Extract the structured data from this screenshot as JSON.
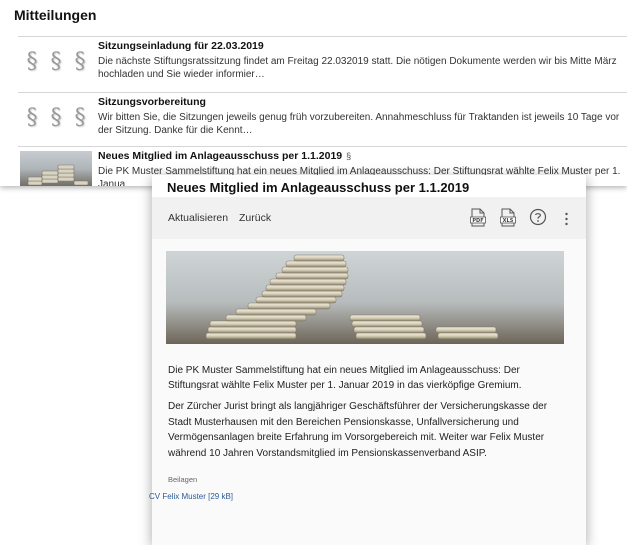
{
  "messages": {
    "heading": "Mitteilungen",
    "items": [
      {
        "title": "Sitzungseinladung für 22.03.2019",
        "body": "Die nächste Stiftungsratssitzung findet am Freitag 22.032019 statt. Die nötigen Dokumente werden wir bis Mitte März hochladen und Sie wieder informier…",
        "thumb": "paragraph-icons"
      },
      {
        "title": "Sitzungsvorbereitung",
        "body": "Wir bitten Sie, die Sitzungen jeweils genug früh vorzubereiten. Annahmeschluss für Traktanden ist jeweils 10 Tage vor der Sitzung. Danke für die Kennt…",
        "thumb": "paragraph-icons"
      },
      {
        "title": "Neues Mitglied im Anlageausschuss per 1.1.2019",
        "flag": "§",
        "body": "Die PK Muster Sammelstiftung hat ein neues Mitglied im Anlageausschuss: Der Stiftungsrat wählte Felix Muster per 1. Janua",
        "thumb": "coin-stack-photo"
      }
    ]
  },
  "dialog": {
    "title": "Neues Mitglied im Anlageausschuss per 1.1.2019",
    "toolbar": {
      "refresh_label": "Aktualisieren",
      "back_label": "Zurück",
      "icons": [
        "pdf-icon",
        "xls-icon",
        "help-icon",
        "more-icon"
      ]
    },
    "paragraph1": "Die PK Muster Sammelstiftung hat ein neues Mitglied im Anlageausschuss: Der Stiftungsrat wählte Felix Muster per 1. Januar 2019 in das vierköpfige Gremium.",
    "paragraph2": "Der Zürcher Jurist bringt als langjähriger Geschäftsführer der Versicherungskasse der Stadt Musterhausen mit den Bereichen Pensionskasse, Unfallversicherung und Vermögensanlagen breite Erfahrung im Vorsorgebereich mit. Weiter war Felix Muster während 10 Jahren Vorstandsmitglied im Pensionskassenverband ASIP.",
    "attachments_label": "Beilagen",
    "attachment": "CV Felix Muster [29 kB]"
  }
}
